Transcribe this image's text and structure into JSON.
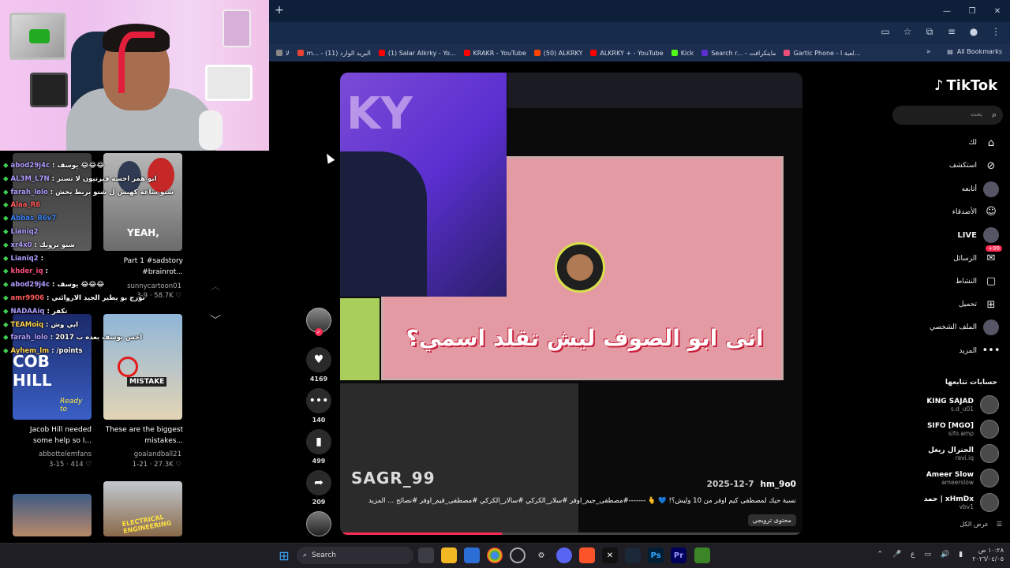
{
  "browser": {
    "new_tab": "+",
    "bookmarks": [
      {
        "label": "لا",
        "color": "#888"
      },
      {
        "label": "m... - (11) البريد الوارد",
        "color": "#ea4335"
      },
      {
        "label": "(1) Salar Alkrky - Yo...",
        "color": "#ff0000"
      },
      {
        "label": "KRAKR - YouTube",
        "color": "#ff0000"
      },
      {
        "label": "(50) ALKRKY",
        "color": "#ff4500"
      },
      {
        "label": "ALKRKY + - YouTube",
        "color": "#ff0000"
      },
      {
        "label": "Kick",
        "color": "#53fc18"
      },
      {
        "label": "Search r... - ماينكرافت",
        "color": "#5b2fd0"
      },
      {
        "label": "Gartic Phone - لعبة ا...",
        "color": "#e94e77"
      }
    ],
    "more": "»",
    "all_bookmarks": "All Bookmarks"
  },
  "chat": [
    {
      "user": "abod29j4c",
      "text": ": يوسف 😂😂😂",
      "color": "#b19cff"
    },
    {
      "user": "AL3M_L7N",
      "text": ": ابو همر احسه فيرتيون لا تستر",
      "color": "#b19cff"
    },
    {
      "user": "farah_lolo",
      "text": ": شنو ساعة كهيس ل شنو بربط يخش",
      "color": "#b19cff"
    },
    {
      "user": "Alaa_R6",
      "text": "",
      "color": "#ff5a5a"
    },
    {
      "user": "Abbas_R6v7",
      "text": "",
      "color": "#3b82f6"
    },
    {
      "user": "Lianiq2",
      "text": "",
      "color": "#b19cff"
    },
    {
      "user": "xr4x0",
      "text": ": شنو ترويك",
      "color": "#b19cff"
    },
    {
      "user": "Lianiq2",
      "text": ":",
      "color": "#b19cff"
    },
    {
      "user": "khder_iq",
      "text": ":",
      "color": "#ff4f7b"
    },
    {
      "user": "abod29j4c",
      "text": ": يوسف 😂😂😂",
      "color": "#b19cff"
    },
    {
      "user": "amr9906",
      "text": ": تورج بو يطير الجيد الاروائتي",
      "color": "#ff5a5a"
    },
    {
      "user": "NADAAiq",
      "text": ": تكفر",
      "color": "#b19cff"
    },
    {
      "user": "TEAMoiq",
      "text": ": ابي وش",
      "color": "#ffd34f"
    },
    {
      "user": "farah_lolo",
      "text": ": احس يوسف بعده ب 2017",
      "color": "#b19cff"
    },
    {
      "user": "Ayhem_lm",
      "text": ": /points",
      "color": "#ffd34f"
    }
  ],
  "thumbnails": [
    {
      "caption": "",
      "author": "",
      "meta": ""
    },
    {
      "caption": "Part 1 #sadstory #brainrot...",
      "author": "sunnycartoon01",
      "meta": "3-9 · 58.7K ♡"
    },
    {
      "caption": "Jacob Hill needed some help so I...",
      "author": "abbottelemfans",
      "meta": "3-15 · 414 ♡"
    },
    {
      "caption": "These are the biggest mistakes...",
      "author": "goalandball21",
      "meta": "1-21 · 27.3K ♡"
    }
  ],
  "thumb_texts": {
    "t2": "YEAH,",
    "t3a": "COB",
    "t3b": "HILL",
    "t3c": "Ready to",
    "t4": "MISTAKE",
    "t6": "ELECTRICAL ENGINEERING"
  },
  "video": {
    "overlay_text": "انى ابو الصوف ليش تقلد اسمي؟",
    "watermark": "SAGR_99",
    "date": "2025-12-7",
    "author": "hm_9o0",
    "description": "نسبة حيك لمصطفى كيم اوفر من 10 وليش؟! 💙 🫰 -------#مصطفى_جيم_اوفر #سلار_الكركي #سالار_الكركي #مصطفى_قيم_اوفر #نصائح ... المزيد",
    "tag": "محتوى ترويجي",
    "progress": 0.35
  },
  "actions": [
    {
      "icon": "heart",
      "count": "4169"
    },
    {
      "icon": "comment",
      "count": "140"
    },
    {
      "icon": "bookmark",
      "count": "499"
    },
    {
      "icon": "share",
      "count": "209"
    }
  ],
  "tiktok": {
    "logo": "TikTok",
    "search_placeholder": "بحث",
    "nav": [
      {
        "label": "لك",
        "icon": "home"
      },
      {
        "label": "استكشف",
        "icon": "compass"
      },
      {
        "label": "أتابعه",
        "icon": "avatar"
      },
      {
        "label": "الأصدقاء",
        "icon": "friends"
      },
      {
        "label": "LIVE",
        "icon": "avatar"
      },
      {
        "label": "الرسائل",
        "icon": "messages",
        "badge": "99+"
      },
      {
        "label": "النشاط",
        "icon": "activity"
      },
      {
        "label": "تحميل",
        "icon": "upload"
      },
      {
        "label": "الملف الشخصي",
        "icon": "avatar"
      },
      {
        "label": "المزيد",
        "icon": "more"
      }
    ],
    "following_title": "حسابات تتابعها",
    "following": [
      {
        "name": "KING SAJAD",
        "handle": "s.d_u01"
      },
      {
        "name": "SIFO [MGO]",
        "handle": "sifo.amp"
      },
      {
        "name": "الجنرال ريغل",
        "handle": "revi.iq"
      },
      {
        "name": "Ameer Slow",
        "handle": "ameerslow"
      },
      {
        "name": "حمد | xHmDx",
        "handle": "vbv1"
      }
    ],
    "see_all": "عرض الكل"
  },
  "taskbar": {
    "search": "Search",
    "clock_time": "١٠:٢٨ ص",
    "clock_date": "٢٠٢٦/٠٤/٠٥",
    "lang": "ع"
  }
}
